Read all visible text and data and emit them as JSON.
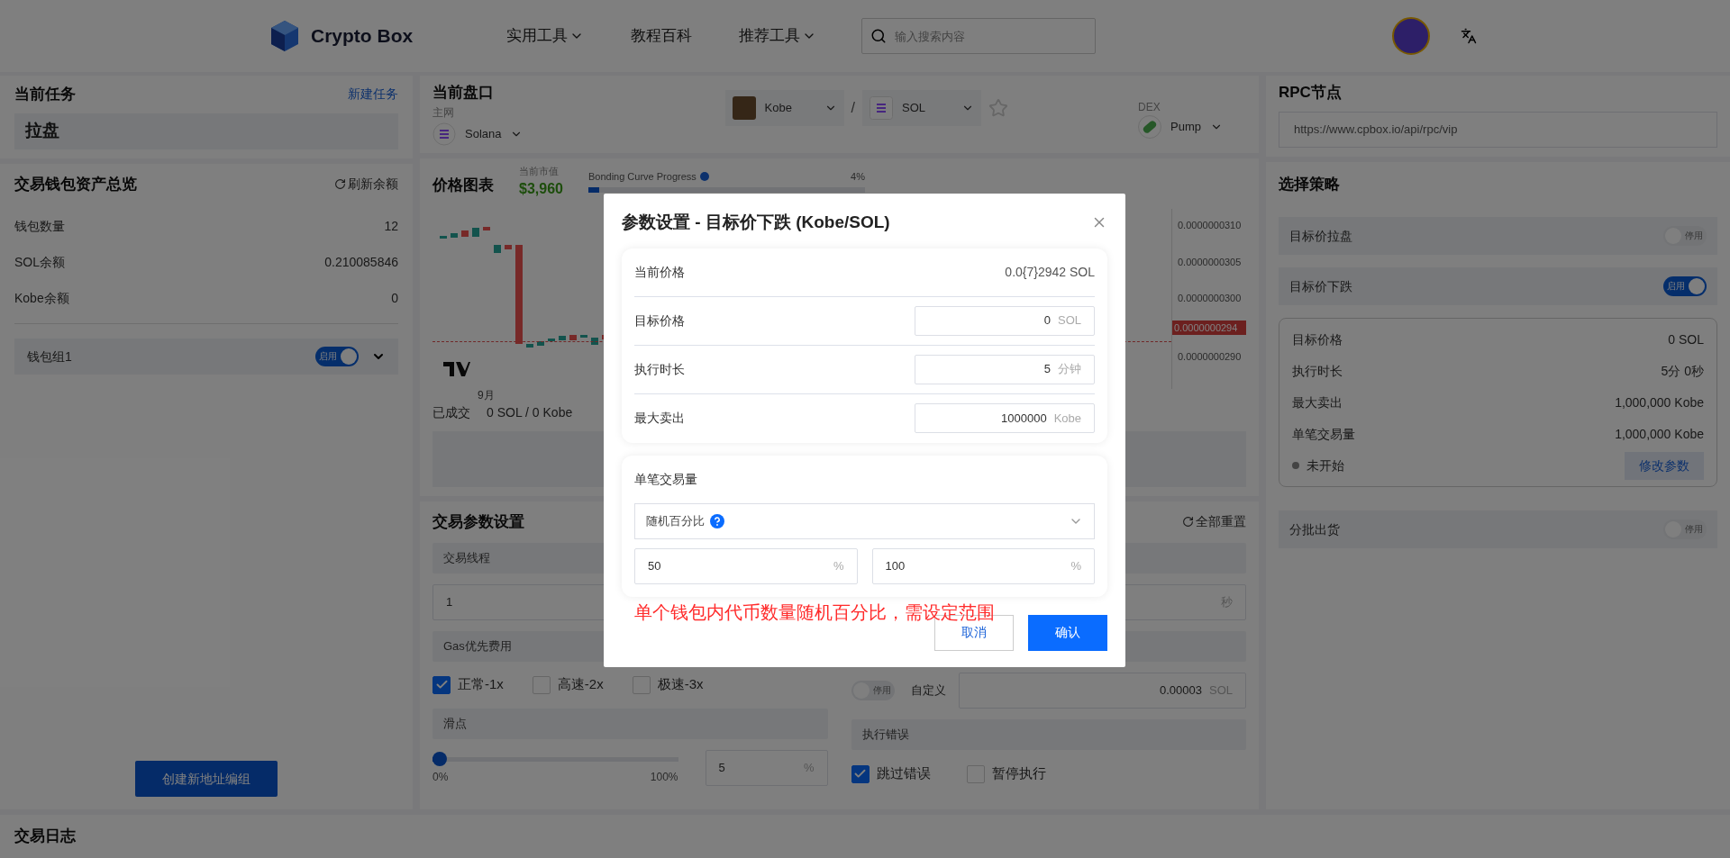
{
  "header": {
    "logo_text": "Crypto Box",
    "nav": [
      {
        "label": "实用工具",
        "dropdown": true
      },
      {
        "label": "教程百科",
        "dropdown": false
      },
      {
        "label": "推荐工具",
        "dropdown": true
      }
    ],
    "search": {
      "placeholder": "输入搜索内容"
    }
  },
  "left": {
    "current_task": {
      "title": "当前任务",
      "link": "新建任务",
      "task": "拉盘"
    },
    "assets": {
      "title": "交易钱包资产总览",
      "refresh": "刷新余额",
      "rows": [
        {
          "label": "钱包数量",
          "value": "12"
        },
        {
          "label": "SOL余额",
          "value": "0.210085846"
        },
        {
          "label": "Kobe余额",
          "value": "0"
        }
      ]
    },
    "wallet_groups": [
      {
        "name": "钱包组1",
        "on": true,
        "toggle_label": "启用"
      }
    ],
    "create_button": "创建新地址编组"
  },
  "market": {
    "title": "当前盘口",
    "network_label": "主网",
    "network": "Solana",
    "base": "Kobe",
    "separator": "/",
    "quote": "SOL",
    "favorite": false,
    "dex_label": "DEX",
    "dex": "Pump"
  },
  "chart": {
    "title": "价格图表",
    "cap_label": "当前市值",
    "cap": "$3,960",
    "bonding_label": "Bonding Curve Progress",
    "bonding_pct": "4%",
    "level": 0.04,
    "price_ticks": [
      "0.0000000310",
      "0.0000000305",
      "0.0000000300",
      "0.0000000290"
    ],
    "current_price": "0.0000000294",
    "month": "9月",
    "filled_label": "已成交",
    "filled": "0 SOL / 0 Kobe"
  },
  "trade_params": {
    "title": "交易参数设置",
    "reset": "全部重置",
    "threads_label": "交易线程",
    "threads": "1",
    "interval_unit": "秒",
    "gas_label": "Gas优先费用",
    "gas_options": [
      {
        "label": "正常-1x",
        "checked": true
      },
      {
        "label": "高速-2x",
        "checked": false
      },
      {
        "label": "极速-3x",
        "checked": false
      }
    ],
    "mev": {
      "on": false,
      "toggle_label": "停用",
      "custom_label": "自定义",
      "value": "0.00003",
      "unit": "SOL"
    },
    "slippage_label": "滑点",
    "slippage": {
      "level": 0.03,
      "min": "0%",
      "max": "100%",
      "value": "5",
      "unit": "%"
    },
    "error_label": "执行错误",
    "error_options": [
      {
        "label": "跳过错误",
        "checked": true
      },
      {
        "label": "暂停执行",
        "checked": false
      }
    ]
  },
  "right": {
    "rpc_title": "RPC节点",
    "rpc": "https://www.cpbox.io/api/rpc/vip",
    "strategy_title": "选择策略",
    "strategies": [
      {
        "name": "目标价拉盘",
        "on": false,
        "toggle_label": "停用"
      },
      {
        "name": "目标价下跌",
        "on": true,
        "toggle_label": "启用",
        "details": [
          {
            "label": "目标价格",
            "value": "0 SOL"
          },
          {
            "label": "执行时长",
            "value": "5分 0秒"
          },
          {
            "label": "最大卖出",
            "value": "1,000,000 Kobe"
          },
          {
            "label": "单笔交易量",
            "value": "1,000,000 Kobe"
          }
        ],
        "status": "未开始",
        "edit": "修改参数"
      },
      {
        "name": "分批出货",
        "on": false,
        "toggle_label": "停用"
      }
    ]
  },
  "log": {
    "title": "交易日志"
  },
  "modal": {
    "title": "参数设置 - 目标价下跌 (Kobe/SOL)",
    "current_label": "当前价格",
    "current": "0.0{7}2942 SOL",
    "fields": [
      {
        "label": "目标价格",
        "value": "0",
        "unit": "SOL"
      },
      {
        "label": "执行时长",
        "value": "5",
        "unit": "分钟"
      },
      {
        "label": "最大卖出",
        "value": "1000000",
        "unit": "Kobe"
      }
    ],
    "amount_label": "单笔交易量",
    "mode": "随机百分比",
    "range": [
      {
        "value": "50",
        "unit": "%"
      },
      {
        "value": "100",
        "unit": "%"
      }
    ],
    "annotation": "单个钱包内代币数量随机百分比，需设定范围",
    "cancel": "取消",
    "confirm": "确认"
  }
}
